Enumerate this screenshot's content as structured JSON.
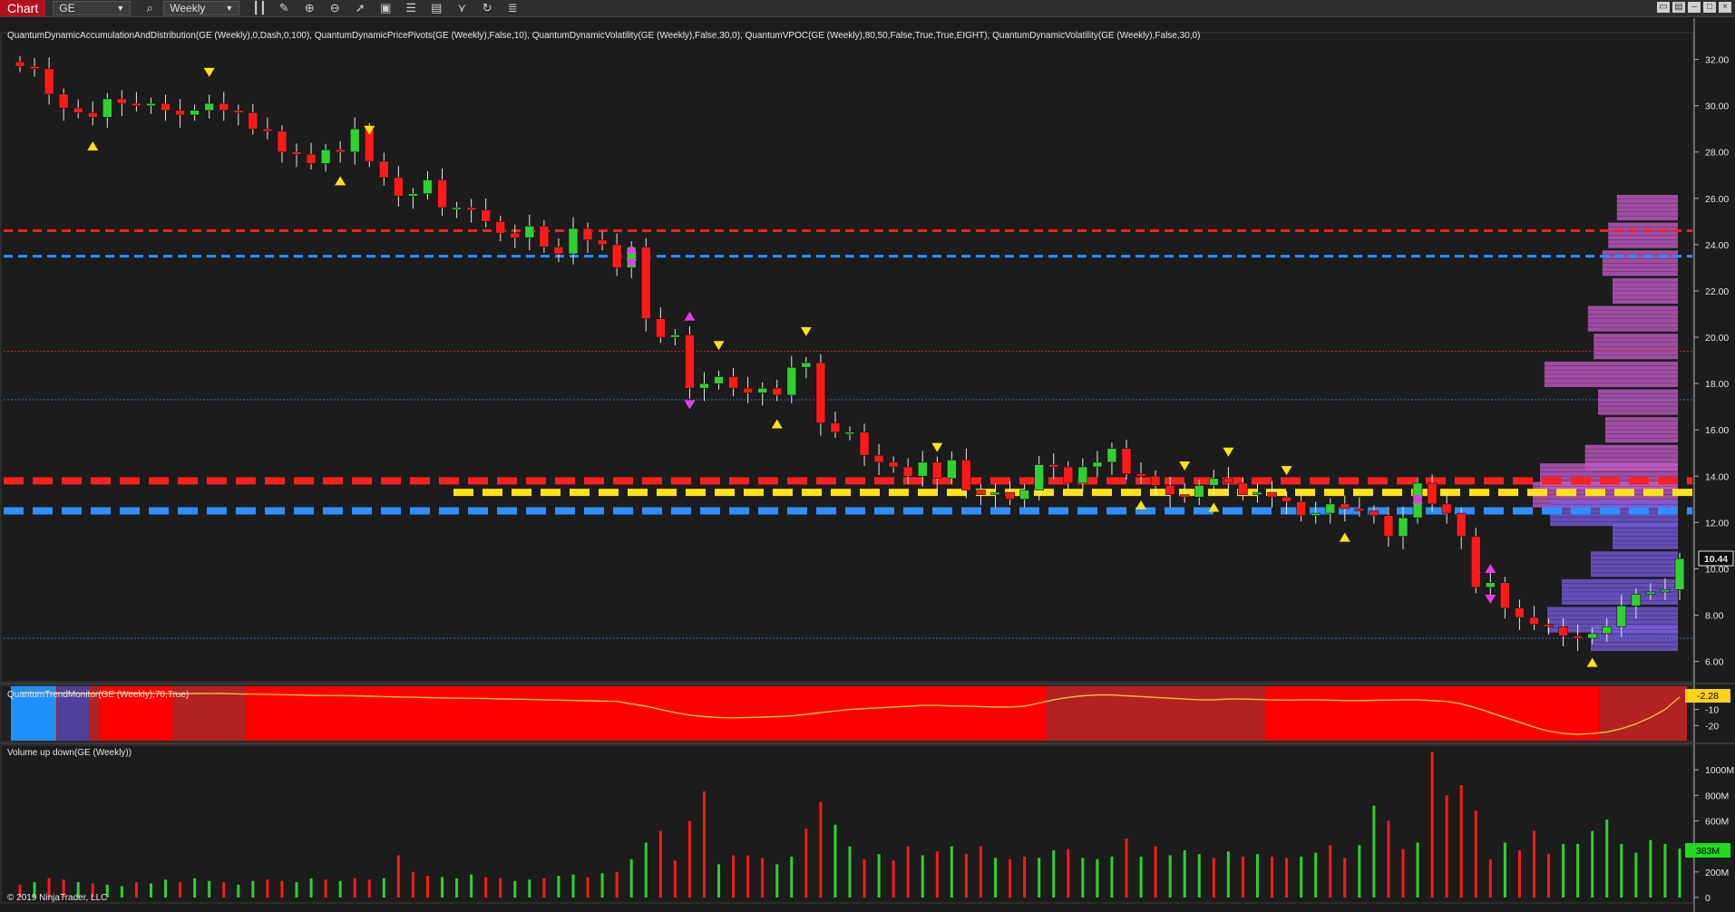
{
  "toolbar": {
    "tab": "Chart",
    "instrument": "GE",
    "interval": "Weekly",
    "icons": [
      "search-icon",
      "bar-type-icon",
      "pencil-icon",
      "zoom-in-icon",
      "zoom-out-icon",
      "cursor-icon",
      "data-box-icon",
      "strategy-icon",
      "indicators-icon",
      "drawing-tools-icon",
      "refresh-icon",
      "properties-icon"
    ]
  },
  "price_panel": {
    "indicators_label": "QuantumDynamicAccumulationAndDistribution(GE (Weekly),0,Dash,0,100), QuantumDynamicPricePivots(GE (Weekly),False,10), QuantumDynamicVolatility(GE (Weekly),False,30,0), QuantumVPOC(GE (Weekly),80,50,False,True,True,EIGHT), QuantumDynamicVolatility(GE (Weekly),False,30,0)",
    "last_price_label": "10.44"
  },
  "trend_panel": {
    "label": "QuantumTrendMonitor(GE (Weekly),70,True)",
    "last_value_label": "-2.28"
  },
  "volume_panel": {
    "label": "Volume up down(GE (Weekly))",
    "last_value_label": "383M"
  },
  "copyright": "© 2019 NinjaTrader, LLC",
  "colors": {
    "up": "#2fd12f",
    "down": "#ff1a1a",
    "resistance": "#ff2020",
    "support": "#2f8fff",
    "vpoc": "#ffe21a",
    "profile_upper": "#c45cc9",
    "profile_lower": "#7a5ce0",
    "trend_bear": "#ff0000",
    "trend_weak": "#b22222",
    "trend_bull": "#1e90ff",
    "trend_line": "#e8c33a"
  },
  "chart_data": [
    {
      "type": "candlestick",
      "symbol": "GE",
      "interval": "Weekly",
      "ylim": [
        5.2,
        33.0
      ],
      "yticks": [
        "6.00",
        "8.00",
        "10.00",
        "12.00",
        "14.00",
        "16.00",
        "18.00",
        "20.00",
        "22.00",
        "24.00",
        "26.00",
        "28.00",
        "30.00",
        "32.00"
      ],
      "closes": [
        31.7,
        31.6,
        30.5,
        29.9,
        29.7,
        29.5,
        30.3,
        30.1,
        30.0,
        30.1,
        29.8,
        29.6,
        29.8,
        30.1,
        29.8,
        29.7,
        29.0,
        28.9,
        28.0,
        27.9,
        27.5,
        28.1,
        28.0,
        29.0,
        27.6,
        26.9,
        26.1,
        26.2,
        26.8,
        25.6,
        25.6,
        25.5,
        25.0,
        24.5,
        24.3,
        24.8,
        23.9,
        23.6,
        24.7,
        24.2,
        24.0,
        23.0,
        23.9,
        20.8,
        20.0,
        20.1,
        17.8,
        18.0,
        18.3,
        17.8,
        17.6,
        17.8,
        17.5,
        18.7,
        18.9,
        16.3,
        15.9,
        15.9,
        14.9,
        14.6,
        14.4,
        14.0,
        14.6,
        13.9,
        14.7,
        13.4,
        13.2,
        13.3,
        13.0,
        13.4,
        14.5,
        14.4,
        13.7,
        14.4,
        14.6,
        15.2,
        14.1,
        14.0,
        13.6,
        13.2,
        13.1,
        13.6,
        13.9,
        13.7,
        13.2,
        13.3,
        13.1,
        12.9,
        12.3,
        12.4,
        12.8,
        12.6,
        12.5,
        12.3,
        11.4,
        12.2,
        13.7,
        12.8,
        12.4,
        11.4,
        9.2,
        9.4,
        8.3,
        7.9,
        7.6,
        7.5,
        7.1,
        7.0,
        7.2,
        7.5,
        8.4,
        8.9,
        9.0,
        9.1,
        10.44
      ],
      "pivots_high_idx": [
        13,
        24,
        48,
        54,
        63,
        80,
        83,
        87
      ],
      "pivots_low_idx": [
        5,
        22,
        52,
        77,
        82,
        91,
        108
      ],
      "volatility_up_idx": [
        42,
        46,
        96,
        101
      ],
      "volatility_down_idx": [
        42,
        46,
        96,
        101
      ],
      "levels": [
        {
          "name": "resistance-major",
          "value": 24.6
        },
        {
          "name": "support-major",
          "value": 23.5
        },
        {
          "name": "resistance-minor",
          "value": 19.4
        },
        {
          "name": "support-minor",
          "value": 17.3
        },
        {
          "name": "resistance",
          "value": 13.8
        },
        {
          "name": "vpoc",
          "value": 13.3
        },
        {
          "name": "support",
          "value": 12.5
        },
        {
          "name": "support-minor-low",
          "value": 7.0
        }
      ],
      "volume_profile": [
        {
          "price": 25.6,
          "size": 0.42
        },
        {
          "price": 24.4,
          "size": 0.48
        },
        {
          "price": 23.2,
          "size": 0.52
        },
        {
          "price": 22.0,
          "size": 0.45
        },
        {
          "price": 20.8,
          "size": 0.62
        },
        {
          "price": 19.6,
          "size": 0.58
        },
        {
          "price": 18.4,
          "size": 0.92
        },
        {
          "price": 17.2,
          "size": 0.55
        },
        {
          "price": 16.0,
          "size": 0.5
        },
        {
          "price": 14.8,
          "size": 0.64
        },
        {
          "price": 14.0,
          "size": 0.95
        },
        {
          "price": 13.2,
          "size": 1.0
        },
        {
          "price": 12.4,
          "size": 0.88
        },
        {
          "price": 11.4,
          "size": 0.45
        },
        {
          "price": 10.2,
          "size": 0.6
        },
        {
          "price": 9.0,
          "size": 0.8
        },
        {
          "price": 7.8,
          "size": 0.9
        },
        {
          "price": 7.0,
          "size": 0.6
        }
      ]
    },
    {
      "type": "line",
      "name": "QuantumTrendMonitor",
      "yticks": [
        "-10",
        "-20"
      ],
      "ylim": [
        -30,
        5
      ],
      "values": [
        0.5,
        0.4,
        0.3,
        0.2,
        0.1,
        0.0,
        0.2,
        0.3,
        0.2,
        0.1,
        0.0,
        -0.2,
        -0.1,
        0.0,
        -0.1,
        -0.3,
        -0.5,
        -0.6,
        -0.8,
        -1.0,
        -1.2,
        -1.3,
        -1.4,
        -1.5,
        -1.8,
        -2.0,
        -2.2,
        -2.4,
        -2.6,
        -2.8,
        -3.0,
        -3.1,
        -3.2,
        -3.4,
        -3.6,
        -3.8,
        -4.0,
        -4.2,
        -4.4,
        -4.6,
        -4.8,
        -5.0,
        -6.5,
        -8.0,
        -10.0,
        -12.0,
        -13.5,
        -14.5,
        -15.0,
        -15.2,
        -15.0,
        -14.8,
        -14.5,
        -14.0,
        -13.0,
        -12.0,
        -11.0,
        -10.0,
        -9.5,
        -9.0,
        -8.5,
        -8.0,
        -7.5,
        -7.5,
        -7.8,
        -8.0,
        -8.2,
        -8.5,
        -8.5,
        -8.0,
        -6.0,
        -4.0,
        -2.5,
        -1.5,
        -1.0,
        -1.0,
        -1.5,
        -2.0,
        -2.5,
        -3.0,
        -3.5,
        -4.0,
        -4.0,
        -3.5,
        -3.5,
        -3.8,
        -4.0,
        -4.2,
        -4.0,
        -4.0,
        -4.2,
        -4.5,
        -4.5,
        -4.3,
        -4.2,
        -4.0,
        -4.0,
        -4.5,
        -5.0,
        -6.5,
        -9.0,
        -12.0,
        -15.0,
        -18.0,
        -21.0,
        -23.5,
        -25.0,
        -25.5,
        -25.0,
        -24.0,
        -22.0,
        -19.0,
        -15.0,
        -10.0,
        -2.28
      ],
      "regime_segments": [
        {
          "state": "bull",
          "start": 0,
          "end": 2
        },
        {
          "state": "weak",
          "start": 3,
          "end": 5
        },
        {
          "state": "bear",
          "start": 6,
          "end": 10
        },
        {
          "state": "weak",
          "start": 11,
          "end": 15
        },
        {
          "state": "bear",
          "start": 16,
          "end": 70
        },
        {
          "state": "weak",
          "start": 71,
          "end": 85
        },
        {
          "state": "bear",
          "start": 86,
          "end": 108
        },
        {
          "state": "weak",
          "start": 109,
          "end": 114
        }
      ]
    },
    {
      "type": "bar",
      "name": "Volume up down",
      "yticks": [
        "1000M",
        "800M",
        "600M",
        "400M",
        "200M",
        "0"
      ],
      "ylim": [
        0,
        1150
      ],
      "values": [
        100,
        120,
        150,
        140,
        120,
        110,
        100,
        90,
        120,
        110,
        140,
        120,
        150,
        130,
        120,
        100,
        130,
        140,
        130,
        120,
        150,
        140,
        130,
        150,
        140,
        150,
        330,
        200,
        170,
        160,
        150,
        180,
        160,
        150,
        130,
        140,
        150,
        170,
        180,
        160,
        190,
        200,
        300,
        430,
        520,
        290,
        600,
        830,
        260,
        330,
        330,
        310,
        260,
        320,
        540,
        750,
        570,
        400,
        300,
        340,
        290,
        400,
        330,
        360,
        400,
        340,
        400,
        310,
        300,
        320,
        310,
        370,
        380,
        310,
        300,
        320,
        460,
        320,
        400,
        330,
        370,
        340,
        310,
        360,
        320,
        340,
        320,
        310,
        320,
        350,
        410,
        310,
        410,
        720,
        600,
        380,
        430,
        1140,
        800,
        880,
        680,
        300,
        430,
        370,
        520,
        340,
        420,
        420,
        520,
        610,
        420,
        350,
        450,
        420,
        383
      ],
      "up_down": [
        "d",
        "u",
        "d",
        "d",
        "u",
        "d",
        "u",
        "u",
        "d",
        "u",
        "u",
        "d",
        "u",
        "u",
        "d",
        "u",
        "u",
        "d",
        "d",
        "u",
        "u",
        "d",
        "u",
        "d",
        "d",
        "u",
        "d",
        "d",
        "d",
        "u",
        "u",
        "u",
        "d",
        "d",
        "u",
        "u",
        "d",
        "u",
        "u",
        "d",
        "u",
        "d",
        "u",
        "u",
        "d",
        "d",
        "d",
        "d",
        "u",
        "d",
        "d",
        "d",
        "u",
        "u",
        "d",
        "d",
        "u",
        "u",
        "d",
        "u",
        "d",
        "d",
        "u",
        "d",
        "u",
        "d",
        "d",
        "u",
        "d",
        "d",
        "u",
        "u",
        "d",
        "u",
        "u",
        "u",
        "d",
        "u",
        "d",
        "u",
        "u",
        "u",
        "d",
        "u",
        "d",
        "u",
        "d",
        "d",
        "u",
        "u",
        "d",
        "d",
        "u",
        "u",
        "d",
        "d",
        "u",
        "d",
        "d",
        "d",
        "d",
        "d",
        "u",
        "d",
        "d",
        "d",
        "u",
        "u",
        "u",
        "u",
        "u",
        "u",
        "u",
        "u",
        "u"
      ]
    }
  ]
}
